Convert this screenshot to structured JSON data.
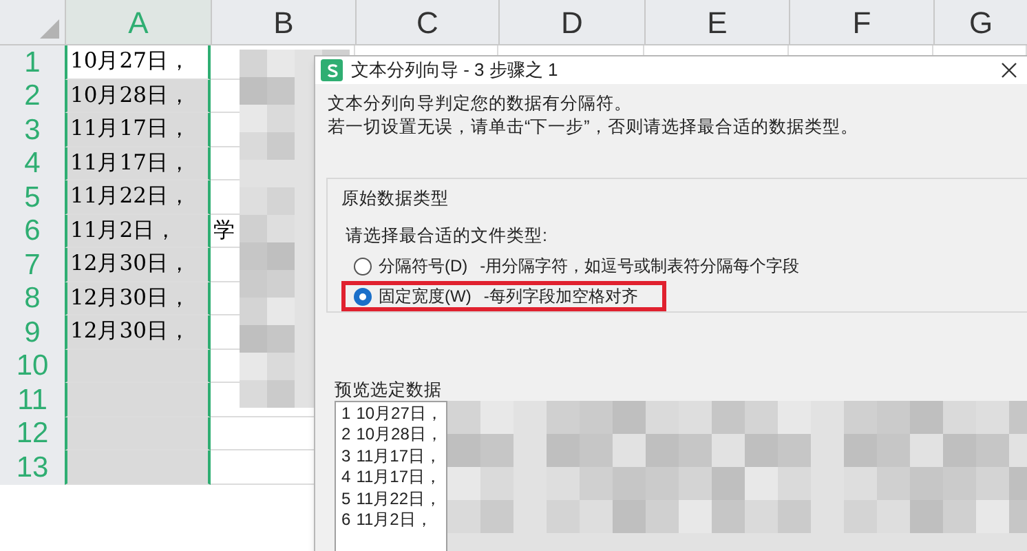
{
  "sheet": {
    "columns": [
      {
        "label": "A",
        "selected": true
      },
      {
        "label": "B",
        "selected": false
      },
      {
        "label": "C",
        "selected": false
      },
      {
        "label": "D",
        "selected": false
      },
      {
        "label": "E",
        "selected": false
      },
      {
        "label": "F",
        "selected": false
      },
      {
        "label": "G",
        "selected": false
      }
    ],
    "rows": [
      {
        "number": "1",
        "cells": [
          "10月27日，"
        ]
      },
      {
        "number": "2",
        "cells": [
          "10月28日，"
        ]
      },
      {
        "number": "3",
        "cells": [
          "11月17日，"
        ]
      },
      {
        "number": "4",
        "cells": [
          "11月17日，"
        ]
      },
      {
        "number": "5",
        "cells": [
          "11月22日，"
        ]
      },
      {
        "number": "6",
        "cells": [
          "11月2日，",
          "学"
        ]
      },
      {
        "number": "7",
        "cells": [
          "12月30日，"
        ]
      },
      {
        "number": "8",
        "cells": [
          "12月30日，"
        ]
      },
      {
        "number": "9",
        "cells": [
          "12月30日，"
        ]
      },
      {
        "number": "10"
      },
      {
        "number": "11"
      },
      {
        "number": "12"
      },
      {
        "number": "13"
      }
    ]
  },
  "dialog": {
    "title": "文本分列向导 - 3 步骤之 1",
    "intro": [
      "文本分列向导判定您的数据有分隔符。",
      "若一切设置无误，请单击“下一步”，否则请选择最合适的数据类型。"
    ],
    "group": {
      "title": "原始数据类型",
      "prompt": "请选择最合适的文件类型:",
      "options": [
        {
          "label": "分隔符号(D)",
          "description": "-用分隔字符，如逗号或制表符分隔每个字段",
          "selected": false,
          "highlighted": false
        },
        {
          "label": "固定宽度(W)",
          "description": "-每列字段加空格对齐",
          "selected": true,
          "highlighted": true
        }
      ]
    },
    "preview": {
      "title": "预览选定数据",
      "lines": [
        {
          "number": "1",
          "text": "10月27日，"
        },
        {
          "number": "2",
          "text": "10月28日，"
        },
        {
          "number": "3",
          "text": "11月17日，"
        },
        {
          "number": "4",
          "text": "11月17日，"
        },
        {
          "number": "5",
          "text": "11月22日，"
        },
        {
          "number": "6",
          "text": "11月2日，"
        }
      ]
    }
  }
}
